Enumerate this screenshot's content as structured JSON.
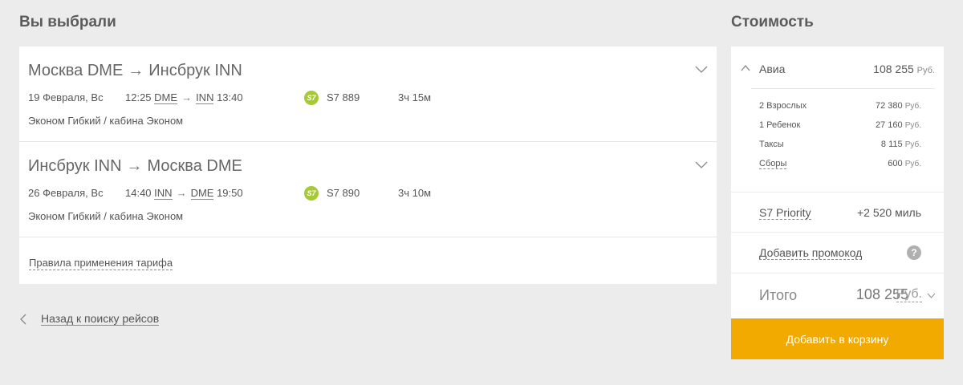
{
  "left_title": "Вы выбрали",
  "right_title": "Стоимость",
  "flights": [
    {
      "from": "Москва DME",
      "to": "Инсбрук INN",
      "arrow": "→",
      "date": "19 Февраля, Вс",
      "dep_time": "12:25",
      "dep_code": "DME",
      "arr_code": "INN",
      "arr_time": "13:40",
      "airline_logo": "S7",
      "flight_number": "S7 889",
      "duration": "3ч 15м",
      "fare": "Эконом Гибкий / кабина Эконом"
    },
    {
      "from": "Инсбрук INN",
      "to": "Москва DME",
      "arrow": "→",
      "date": "26 Февраля, Вс",
      "dep_time": "14:40",
      "dep_code": "INN",
      "arr_code": "DME",
      "arr_time": "19:50",
      "airline_logo": "S7",
      "flight_number": "S7 890",
      "duration": "3ч 10м",
      "fare": "Эконом Гибкий / кабина Эконом"
    }
  ],
  "tariff_rules_link": "Правила применения тарифа",
  "back_link": "Назад к поиску рейсов",
  "price": {
    "avia_label": "Авиа",
    "avia_amount": "108 255",
    "currency_short": "Руб.",
    "breakdown": [
      {
        "label": "2 Взрослых",
        "value": "72 380"
      },
      {
        "label": "1 Ребенок",
        "value": "27 160"
      },
      {
        "label": "Таксы",
        "value": "8 115"
      },
      {
        "label": "Сборы",
        "value": "600"
      }
    ],
    "priority_label": "S7 Priority",
    "priority_value": "+2 520 миль",
    "promo_label": "Добавить промокод",
    "help_glyph": "?",
    "total_label": "Итого",
    "total_amount": "108 255",
    "total_currency": "Руб."
  },
  "add_to_cart": "Добавить в корзину",
  "colors": {
    "accent": "#f2aa00",
    "s7_logo": "#a8c936",
    "background": "#ececec"
  }
}
